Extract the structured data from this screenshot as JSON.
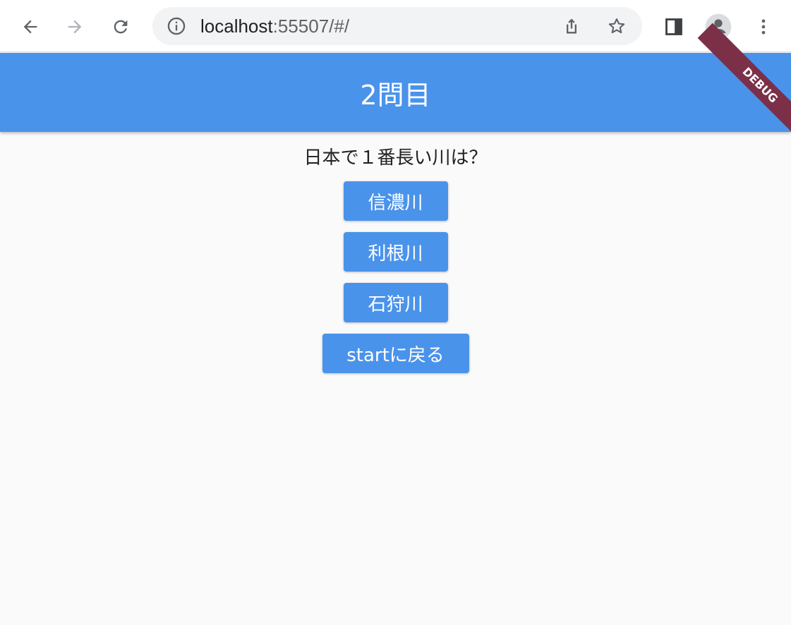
{
  "browser": {
    "url_host": "localhost",
    "url_rest": ":55507/#/"
  },
  "app": {
    "title": "2問目",
    "debug_label": "DEBUG",
    "accent_color": "#4a93eb"
  },
  "quiz": {
    "question": "日本で１番長い川は？",
    "answers": [
      {
        "label": "信濃川"
      },
      {
        "label": "利根川"
      },
      {
        "label": "石狩川"
      }
    ],
    "back_label": "startに戻る"
  },
  "icons": {
    "back": "arrow-left-icon",
    "forward": "arrow-right-icon",
    "reload": "reload-icon",
    "info": "info-icon",
    "share": "share-icon",
    "bookmark": "star-icon",
    "sidepanel": "side-panel-icon",
    "profile": "profile-icon",
    "menu": "more-vert-icon"
  }
}
